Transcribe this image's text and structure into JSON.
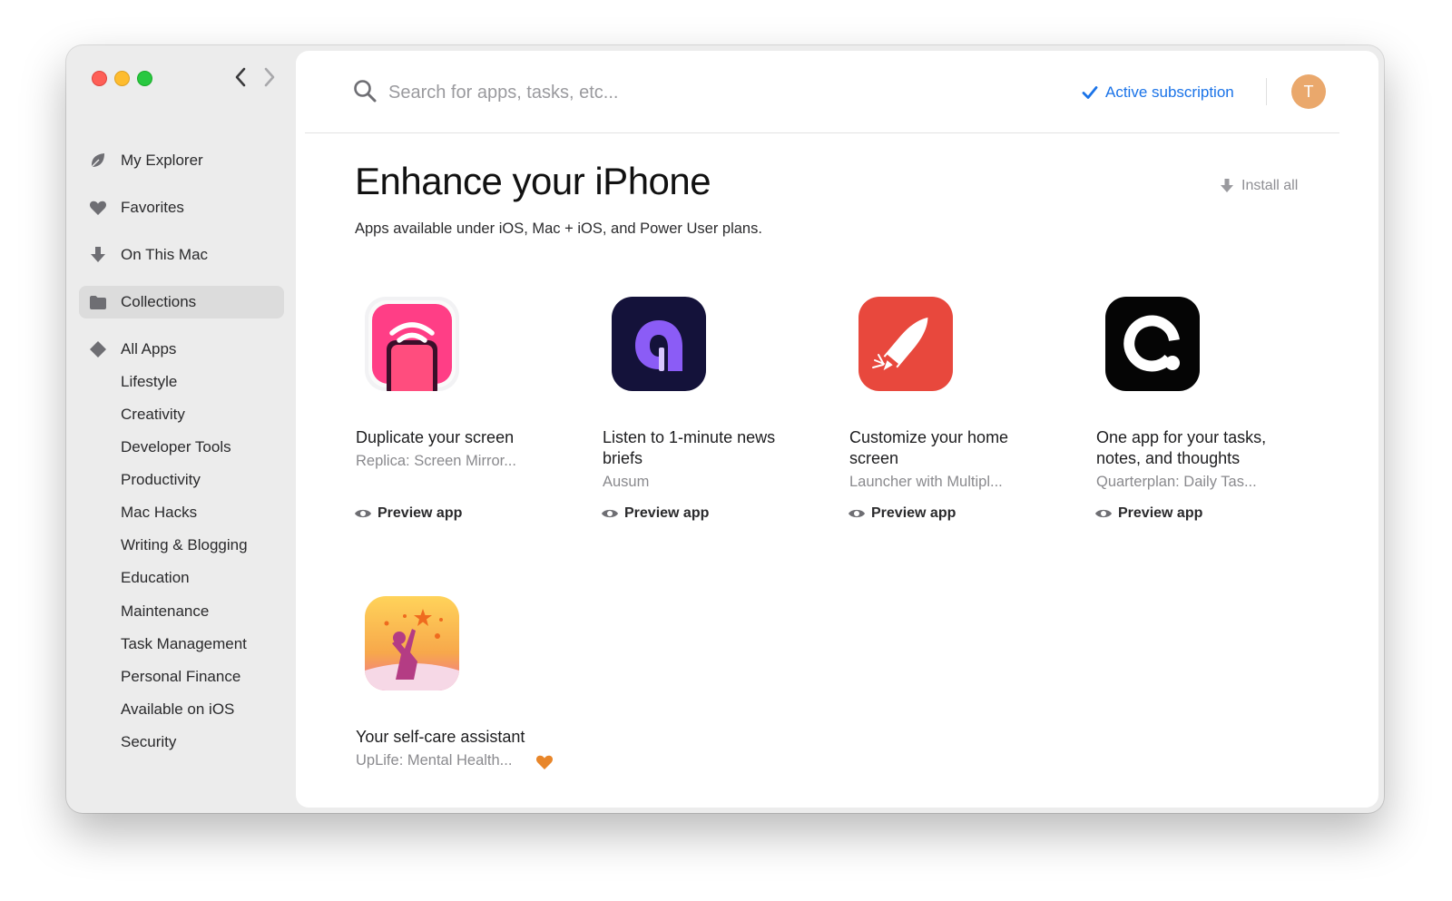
{
  "sidebar": {
    "main_items": [
      {
        "label": "My Explorer",
        "icon": "leaf-icon"
      },
      {
        "label": "Favorites",
        "icon": "heart-icon"
      },
      {
        "label": "On This Mac",
        "icon": "download-arrow-icon"
      },
      {
        "label": "Collections",
        "icon": "folder-icon",
        "selected": true
      }
    ],
    "all_apps": {
      "label": "All Apps",
      "icon": "diamond-icon"
    },
    "categories": [
      "Lifestyle",
      "Creativity",
      "Developer Tools",
      "Productivity",
      "Mac Hacks",
      "Writing & Blogging",
      "Education",
      "Maintenance",
      "Task Management",
      "Personal Finance",
      "Available on iOS",
      "Security"
    ]
  },
  "header": {
    "search_placeholder": "Search for apps, tasks, etc...",
    "subscription_label": "Active subscription",
    "avatar_initial": "T"
  },
  "page": {
    "title": "Enhance your iPhone",
    "subtitle": "Apps available under iOS, Mac + iOS, and Power User plans.",
    "install_all_label": "Install all"
  },
  "apps": [
    {
      "title": "Duplicate your screen",
      "app_name": "Replica: Screen Mirror...",
      "action": "Preview app",
      "icon": "replica-icon"
    },
    {
      "title": "Listen to 1-minute news briefs",
      "app_name": "Ausum",
      "action": "Preview app",
      "icon": "ausum-icon"
    },
    {
      "title": "Customize your home screen",
      "app_name": "Launcher with Multipl...",
      "action": "Preview app",
      "icon": "launcher-rocket-icon"
    },
    {
      "title": "One app for your tasks, notes, and thoughts",
      "app_name": "Quarterplan: Daily Tas...",
      "action": "Preview app",
      "icon": "quarterplan-icon"
    },
    {
      "title": "Your self-care assistant",
      "app_name": "UpLife: Mental Health...",
      "favorited": true,
      "icon": "uplife-icon"
    }
  ],
  "colors": {
    "accent_blue": "#1a73e8",
    "avatar": "#eaa86c",
    "favorite_heart": "#e8862a",
    "sidebar_bg": "#ececec"
  }
}
